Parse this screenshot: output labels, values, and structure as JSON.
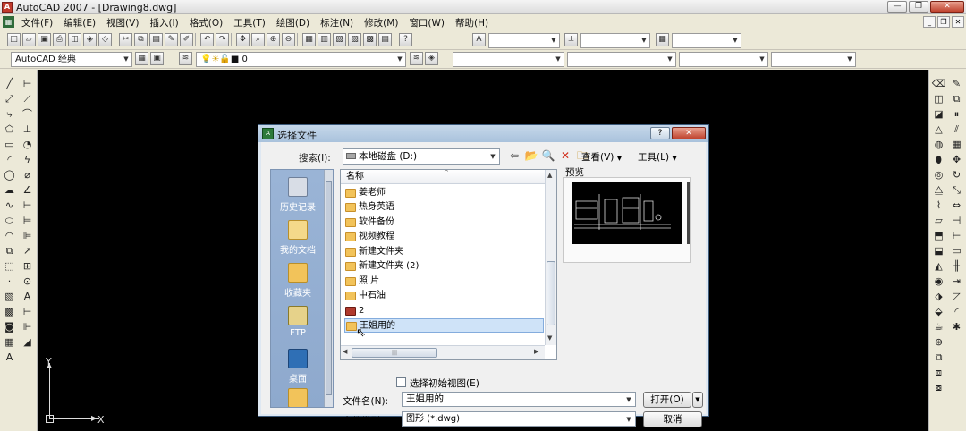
{
  "window": {
    "title": "AutoCAD 2007 - [Drawing8.dwg]",
    "app_icon": "autocad-icon"
  },
  "menubar": {
    "items": [
      "文件(F)",
      "编辑(E)",
      "视图(V)",
      "插入(I)",
      "格式(O)",
      "工具(T)",
      "绘图(D)",
      "标注(N)",
      "修改(M)",
      "窗口(W)",
      "帮助(H)"
    ]
  },
  "toolbar2": {
    "workspace": "AutoCAD 经典",
    "layer": "0"
  },
  "canvas": {
    "ucs_x": "X",
    "ucs_y": "Y"
  },
  "dialog": {
    "title": "选择文件",
    "search_label": "搜索(I):",
    "search_value": "本地磁盘 (D:)",
    "view_menu": "查看(V)",
    "tools_menu": "工具(L)",
    "preview_label": "预览",
    "column_name": "名称",
    "places": [
      {
        "label": "历史记录",
        "icon": "history-icon"
      },
      {
        "label": "我的文档",
        "icon": "documents-icon"
      },
      {
        "label": "收藏夹",
        "icon": "favorites-icon"
      },
      {
        "label": "FTP",
        "icon": "ftp-icon"
      },
      {
        "label": "桌面",
        "icon": "desktop-icon"
      }
    ],
    "files": [
      {
        "name": "姜老师",
        "type": "folder"
      },
      {
        "name": "热身英语",
        "type": "folder"
      },
      {
        "name": "软件备份",
        "type": "folder"
      },
      {
        "name": "视频教程",
        "type": "folder"
      },
      {
        "name": "新建文件夹",
        "type": "folder"
      },
      {
        "name": "新建文件夹 (2)",
        "type": "folder"
      },
      {
        "name": "照 片",
        "type": "folder"
      },
      {
        "name": "中石油",
        "type": "folder"
      },
      {
        "name": "2",
        "type": "dwg"
      },
      {
        "name": "王姐用的",
        "type": "folder",
        "selected": true
      }
    ],
    "init_view_label": "选择初始视图(E)",
    "filename_label": "文件名(N):",
    "filename_value": "王姐用的",
    "filetype_label": "文件类型(T):",
    "filetype_value": "图形 (*.dwg)",
    "open_button": "打开(O)",
    "cancel_button": "取消",
    "help_button": "?",
    "close_button": "✕"
  }
}
